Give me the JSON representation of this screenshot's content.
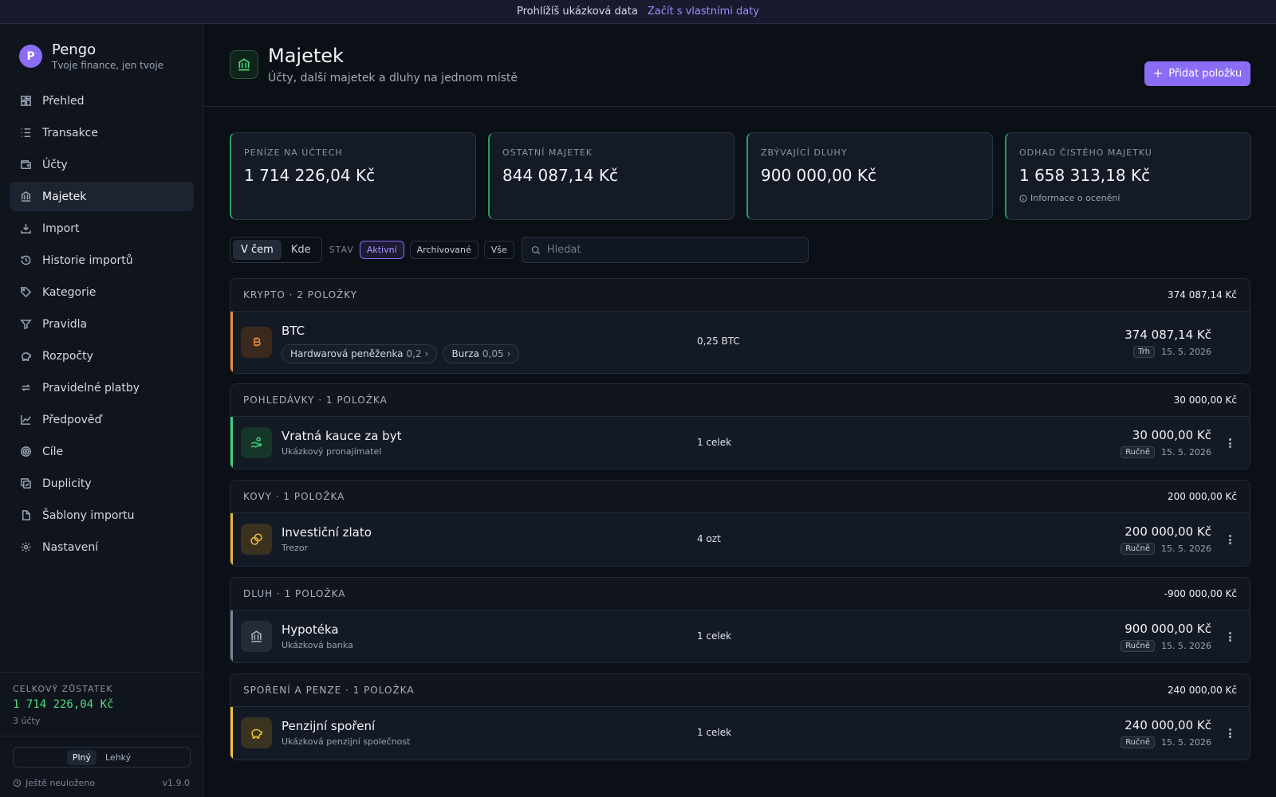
{
  "banner": {
    "text": "Prohlížíš ukázková data",
    "link": "Začít s vlastními daty"
  },
  "brand": {
    "logo": "P",
    "name": "Pengo",
    "tagline": "Tvoje finance, jen tvoje"
  },
  "nav": [
    {
      "label": "Přehled",
      "icon": "dashboard-icon"
    },
    {
      "label": "Transakce",
      "icon": "list-icon"
    },
    {
      "label": "Účty",
      "icon": "wallet-icon"
    },
    {
      "label": "Majetek",
      "icon": "bank-icon",
      "active": true
    },
    {
      "label": "Import",
      "icon": "download-icon"
    },
    {
      "label": "Historie importů",
      "icon": "history-icon"
    },
    {
      "label": "Kategorie",
      "icon": "tag-icon"
    },
    {
      "label": "Pravidla",
      "icon": "filter-icon"
    },
    {
      "label": "Rozpočty",
      "icon": "piggy-icon"
    },
    {
      "label": "Pravidelné platby",
      "icon": "repeat-icon"
    },
    {
      "label": "Předpověď",
      "icon": "chart-icon"
    },
    {
      "label": "Cíle",
      "icon": "target-icon"
    },
    {
      "label": "Duplicity",
      "icon": "duplicate-icon"
    },
    {
      "label": "Šablony importu",
      "icon": "template-icon"
    },
    {
      "label": "Nastavení",
      "icon": "gear-icon"
    }
  ],
  "sidebar_balance": {
    "label": "CELKOVÝ ZŮSTATEK",
    "value": "1 714 226,04 Kč",
    "accounts": "3 účty"
  },
  "mode": {
    "full": "Plný",
    "light": "Lehký",
    "selected": "Plný"
  },
  "save": {
    "status": "Ještě neuloženo",
    "version": "v1.9.0"
  },
  "header": {
    "title": "Majetek",
    "subtitle": "Účty, další majetek a dluhy na jednom místě",
    "add_button": "Přidat položku"
  },
  "stats": [
    {
      "label": "PENÍZE NA ÚČTECH",
      "value": "1 714 226,04 Kč"
    },
    {
      "label": "OSTATNÍ MAJETEK",
      "value": "844 087,14 Kč"
    },
    {
      "label": "ZBÝVAJÍCÍ DLUHY",
      "value": "900 000,00 Kč"
    },
    {
      "label": "ODHAD ČISTÉHO MAJETKU",
      "value": "1 658 313,18 Kč",
      "note": "Informace o ocenění"
    }
  ],
  "filters": {
    "view_tabs": [
      "V čem",
      "Kde"
    ],
    "view_selected": "V čem",
    "status_label": "STAV",
    "status_options": [
      "Aktivní",
      "Archivované",
      "Vše"
    ],
    "status_selected": "Aktivní",
    "search_placeholder": "Hledat"
  },
  "groups": [
    {
      "title": "KRYPTO · 2 POLOŽKY",
      "total": "374 087,14 Kč",
      "color": "#f08a3c",
      "item": {
        "name": "BTC",
        "quantity": "0,25 BTC",
        "amount": "374 087,14 Kč",
        "source": "Trh",
        "date": "15. 5. 2026",
        "icon": "bitcoin-icon",
        "locations": [
          {
            "label": "Hardwarová peněženka",
            "value": "0,2"
          },
          {
            "label": "Burza",
            "value": "0,05"
          }
        ]
      }
    },
    {
      "title": "POHLEDÁVKY · 1 POLOŽKA",
      "total": "30 000,00 Kč",
      "color": "#3fcf7a",
      "item": {
        "name": "Vratná kauce za byt",
        "desc": "Ukázkový pronajímatel",
        "quantity": "1 celek",
        "amount": "30 000,00 Kč",
        "source": "Ručně",
        "date": "15. 5. 2026",
        "icon": "hand-coins-icon"
      }
    },
    {
      "title": "KOVY · 1 POLOŽKA",
      "total": "200 000,00 Kč",
      "color": "#e9b23c",
      "item": {
        "name": "Investiční zlato",
        "desc": "Trezor",
        "quantity": "4 ozt",
        "amount": "200 000,00 Kč",
        "source": "Ručně",
        "date": "15. 5. 2026",
        "icon": "coins-icon"
      }
    },
    {
      "title": "DLUH · 1 POLOŽKA",
      "total": "-900 000,00 Kč",
      "color": "#7a8496",
      "item": {
        "name": "Hypotéka",
        "desc": "Ukázková banka",
        "quantity": "1 celek",
        "amount": "900 000,00 Kč",
        "source": "Ručně",
        "date": "15. 5. 2026",
        "icon": "bank-icon"
      }
    },
    {
      "title": "SPOŘENÍ A PENZE · 1 POLOŽKA",
      "total": "240 000,00 Kč",
      "color": "#f1c232",
      "item": {
        "name": "Penzijní spoření",
        "desc": "Ukázková penzijní společnost",
        "quantity": "1 celek",
        "amount": "240 000,00 Kč",
        "source": "Ručně",
        "date": "15. 5. 2026",
        "icon": "piggy-bank-icon"
      }
    }
  ]
}
